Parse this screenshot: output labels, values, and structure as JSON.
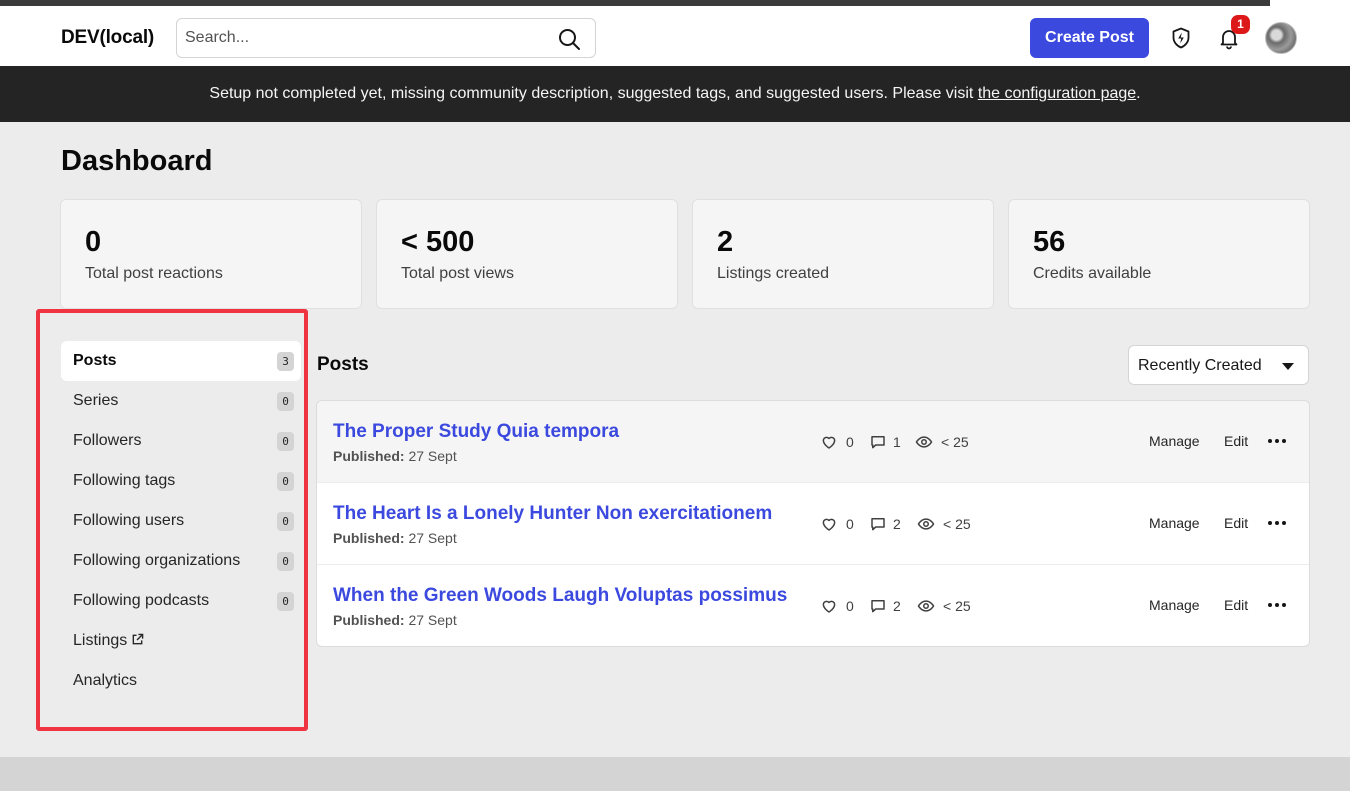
{
  "header": {
    "logo": "DEV(local)",
    "search_placeholder": "Search...",
    "create_post_label": "Create Post",
    "notification_count": "1"
  },
  "banner": {
    "text": "Setup not completed yet, missing community description, suggested tags, and suggested users. Please visit ",
    "link_text": "the configuration page",
    "suffix": "."
  },
  "dashboard": {
    "title": "Dashboard",
    "stats": [
      {
        "value": "0",
        "label": "Total post reactions"
      },
      {
        "value": "< 500",
        "label": "Total post views"
      },
      {
        "value": "2",
        "label": "Listings created"
      },
      {
        "value": "56",
        "label": "Credits available"
      }
    ]
  },
  "sidebar": {
    "items": [
      {
        "label": "Posts",
        "count": "3"
      },
      {
        "label": "Series",
        "count": "0"
      },
      {
        "label": "Followers",
        "count": "0"
      },
      {
        "label": "Following tags",
        "count": "0"
      },
      {
        "label": "Following users",
        "count": "0"
      },
      {
        "label": "Following organizations",
        "count": "0"
      },
      {
        "label": "Following podcasts",
        "count": "0"
      },
      {
        "label": "Listings"
      },
      {
        "label": "Analytics"
      }
    ]
  },
  "posts": {
    "heading": "Posts",
    "sort_value": "Recently Created",
    "manage_label": "Manage",
    "edit_label": "Edit",
    "published_label": "Published:",
    "items": [
      {
        "title": "The Proper Study Quia tempora",
        "date": "27 Sept",
        "reactions": "0",
        "comments": "1",
        "views": "< 25"
      },
      {
        "title": "The Heart Is a Lonely Hunter Non exercitationem",
        "date": "27 Sept",
        "reactions": "0",
        "comments": "2",
        "views": "< 25"
      },
      {
        "title": "When the Green Woods Laugh Voluptas possimus",
        "date": "27 Sept",
        "reactions": "0",
        "comments": "2",
        "views": "< 25"
      }
    ]
  },
  "colors": {
    "accent": "#3b49df",
    "highlight_border": "#ef3340",
    "banner_bg": "#242424",
    "badge": "#dc1818"
  }
}
